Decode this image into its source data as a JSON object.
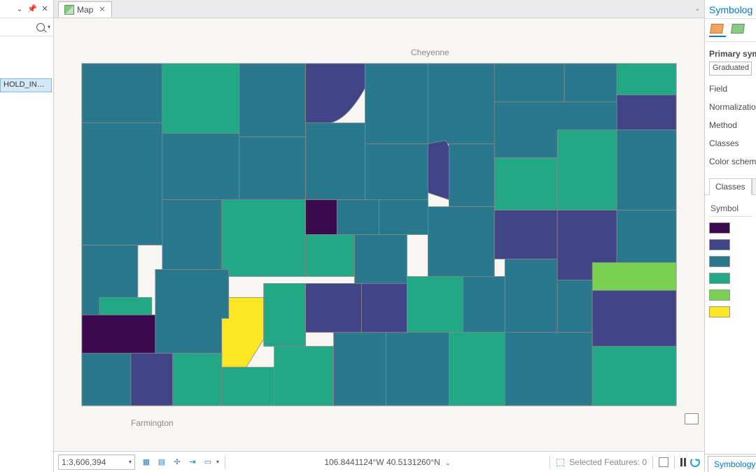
{
  "left_pane": {
    "toc_item": "HOLD_INCO…"
  },
  "map_tab": {
    "label": "Map"
  },
  "basemap_labels": {
    "top": "Cheyenne",
    "bottom": "Farmington"
  },
  "status": {
    "scale": "1:3,606,394",
    "coords": "106.8441124°W 40.5131260°N",
    "selected_label": "Selected Features: 0"
  },
  "symbology": {
    "title": "Symbolog",
    "section": "Primary sym",
    "combo": "Graduated Co",
    "fields": [
      "Field",
      "Normalization",
      "Method",
      "Classes",
      "Color scheme"
    ],
    "tabs": {
      "active": "Classes",
      "other": "Hi"
    },
    "col_header": "Symbol",
    "swatches": [
      "#3b0a4e",
      "#414487",
      "#2a788e",
      "#22a884",
      "#7ad151",
      "#fde725"
    ],
    "footer": "Symbology"
  },
  "chart_data": {
    "type": "choropleth",
    "region": "Colorado counties",
    "classification": "Graduated Colors, 6 classes",
    "color_ramp": "viridis",
    "class_colors": [
      "#3b0a4e",
      "#414487",
      "#2a788e",
      "#22a884",
      "#7ad151",
      "#fde725"
    ],
    "note": "County polygons shaded by HOUSEHOLD_INCOME classes; specific county values not labeled."
  }
}
